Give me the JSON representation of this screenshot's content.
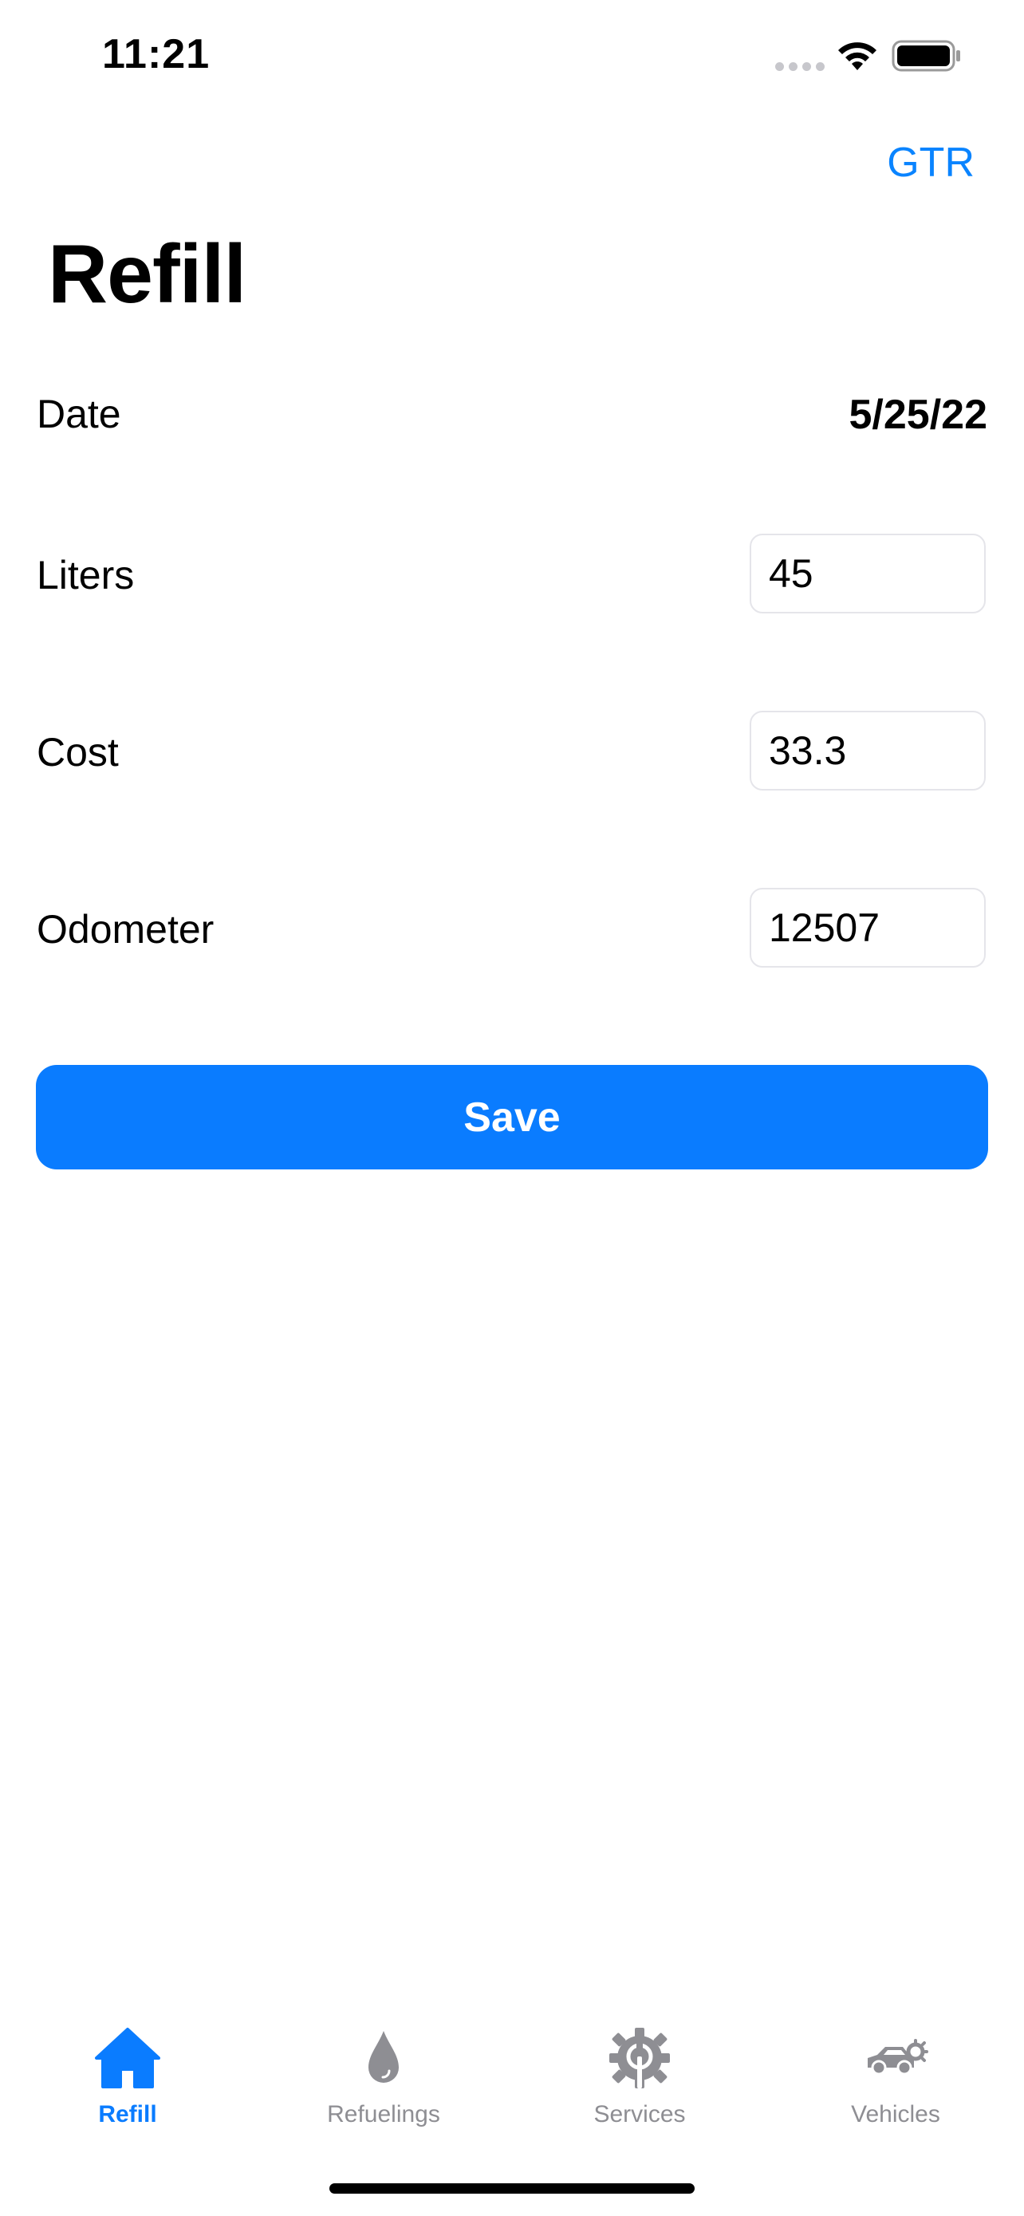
{
  "status_bar": {
    "time": "11:21"
  },
  "header": {
    "vehicle": "GTR",
    "title": "Refill"
  },
  "form": {
    "date_label": "Date",
    "date_value": "5/25/22",
    "liters_label": "Liters",
    "liters_value": "45",
    "cost_label": "Cost",
    "cost_value": "33.3",
    "odometer_label": "Odometer",
    "odometer_value": "12507",
    "save_label": "Save"
  },
  "tabs": [
    {
      "label": "Refill",
      "icon": "house-icon",
      "active": true
    },
    {
      "label": "Refuelings",
      "icon": "drop-icon",
      "active": false
    },
    {
      "label": "Services",
      "icon": "gear-wrench-icon",
      "active": false
    },
    {
      "label": "Vehicles",
      "icon": "car-icon",
      "active": false
    }
  ],
  "colors": {
    "accent": "#0a7cff",
    "inactive": "#8e8e93"
  }
}
